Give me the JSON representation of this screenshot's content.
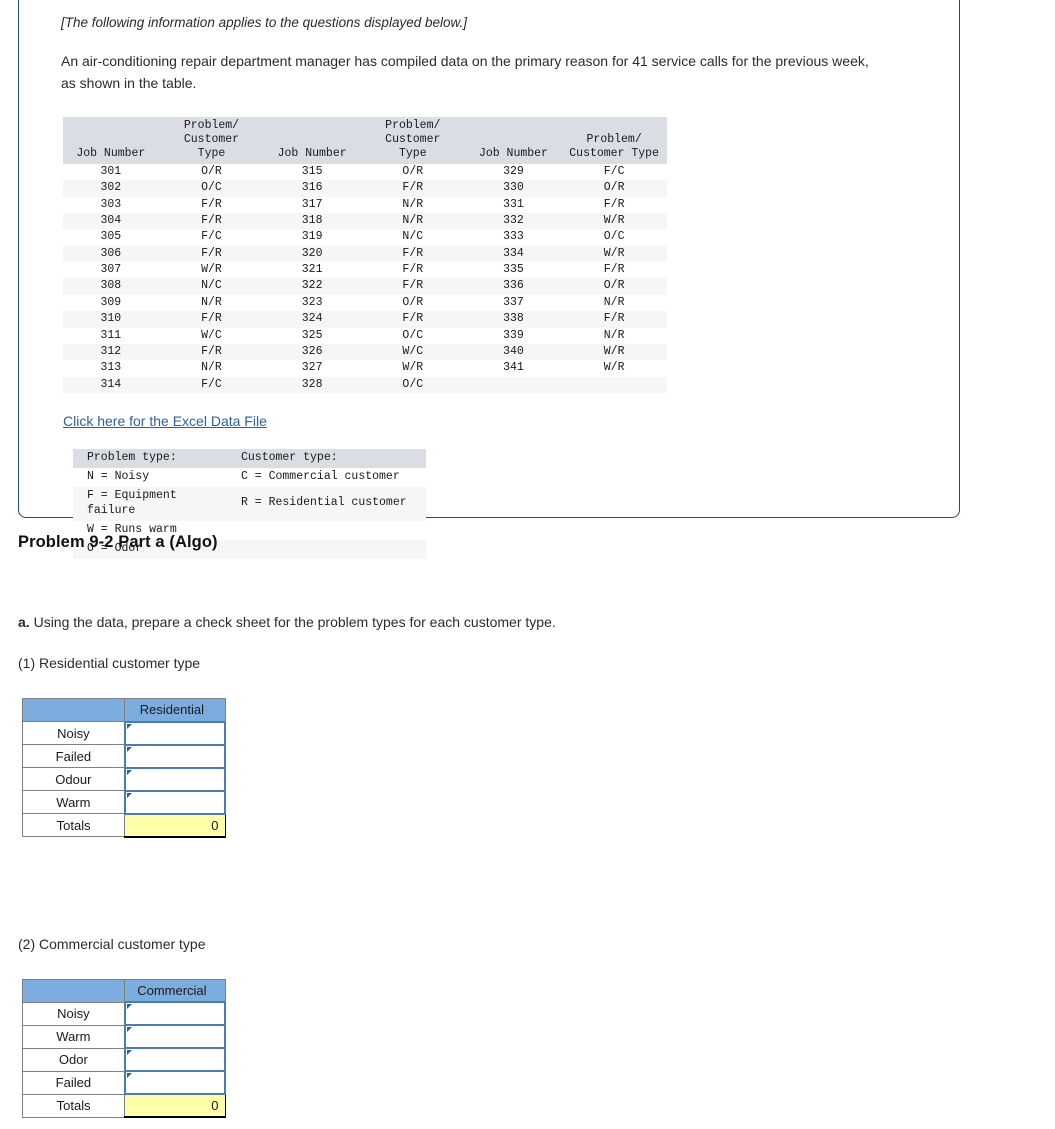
{
  "info_panel": {
    "note": "[The following information applies to the questions displayed below.]",
    "body": "An air-conditioning repair department manager has compiled data on the primary reason for 41 service calls for the previous week, as shown in the table.",
    "excel_link": "Click here for the Excel Data File"
  },
  "data_table": {
    "headers": [
      {
        "job": "Job Number",
        "type": "Problem/\nCustomer Type"
      },
      {
        "job": "Job Number",
        "type": "Problem/\nCustomer Type"
      },
      {
        "job": "Job Number",
        "type": "Problem/\nCustomer Type"
      }
    ],
    "rows": [
      {
        "job1": "301",
        "type1": "O/R",
        "job2": "315",
        "type2": "O/R",
        "job3": "329",
        "type3": "F/C"
      },
      {
        "job1": "302",
        "type1": "O/C",
        "job2": "316",
        "type2": "F/R",
        "job3": "330",
        "type3": "O/R"
      },
      {
        "job1": "303",
        "type1": "F/R",
        "job2": "317",
        "type2": "N/R",
        "job3": "331",
        "type3": "F/R"
      },
      {
        "job1": "304",
        "type1": "F/R",
        "job2": "318",
        "type2": "N/R",
        "job3": "332",
        "type3": "W/R"
      },
      {
        "job1": "305",
        "type1": "F/C",
        "job2": "319",
        "type2": "N/C",
        "job3": "333",
        "type3": "O/C"
      },
      {
        "job1": "306",
        "type1": "F/R",
        "job2": "320",
        "type2": "F/R",
        "job3": "334",
        "type3": "W/R"
      },
      {
        "job1": "307",
        "type1": "W/R",
        "job2": "321",
        "type2": "F/R",
        "job3": "335",
        "type3": "F/R"
      },
      {
        "job1": "308",
        "type1": "N/C",
        "job2": "322",
        "type2": "F/R",
        "job3": "336",
        "type3": "O/R"
      },
      {
        "job1": "309",
        "type1": "N/R",
        "job2": "323",
        "type2": "O/R",
        "job3": "337",
        "type3": "N/R"
      },
      {
        "job1": "310",
        "type1": "F/R",
        "job2": "324",
        "type2": "F/R",
        "job3": "338",
        "type3": "F/R"
      },
      {
        "job1": "311",
        "type1": "W/C",
        "job2": "325",
        "type2": "O/C",
        "job3": "339",
        "type3": "N/R"
      },
      {
        "job1": "312",
        "type1": "F/R",
        "job2": "326",
        "type2": "W/C",
        "job3": "340",
        "type3": "W/R"
      },
      {
        "job1": "313",
        "type1": "N/R",
        "job2": "327",
        "type2": "W/R",
        "job3": "341",
        "type3": "W/R"
      },
      {
        "job1": "314",
        "type1": "F/C",
        "job2": "328",
        "type2": "O/C",
        "job3": "",
        "type3": ""
      }
    ]
  },
  "legend": {
    "header_left": "Problem type:",
    "header_right": "Customer type:",
    "left_items": [
      "N = Noisy",
      "F = Equipment failure",
      "W = Runs warm",
      "O = Odor"
    ],
    "right_items": [
      "C = Commercial customer",
      "R = Residential customer"
    ]
  },
  "question": {
    "title": "Problem 9-2 Part a (Algo)",
    "part_prefix": "a.",
    "part_text": " Using the data, prepare a check sheet for the problem types for each customer type.",
    "sub1": "(1) Residential customer type",
    "sub2": "(2) Commercial customer type"
  },
  "sheet_residential": {
    "column_header": "Residential",
    "rows": [
      "Noisy",
      "Failed",
      "Odour",
      "Warm"
    ],
    "totals_label": "Totals",
    "totals_value": "0",
    "inputs": [
      "",
      "",
      "",
      ""
    ]
  },
  "sheet_commercial": {
    "column_header": "Commercial",
    "rows": [
      "Noisy",
      "Warm",
      "Odor",
      "Failed"
    ],
    "totals_label": "Totals",
    "totals_value": "0",
    "inputs": [
      "",
      "",
      "",
      ""
    ]
  },
  "colors": {
    "panel_border": "#1f4e79",
    "table_header_bg": "#dadde4",
    "zebra_bg": "#f6f6f6",
    "sheet_header_bg": "#7cadde",
    "input_border": "#4a7db5",
    "total_bg": "#ffffaa",
    "link": "#2b5fa8"
  }
}
